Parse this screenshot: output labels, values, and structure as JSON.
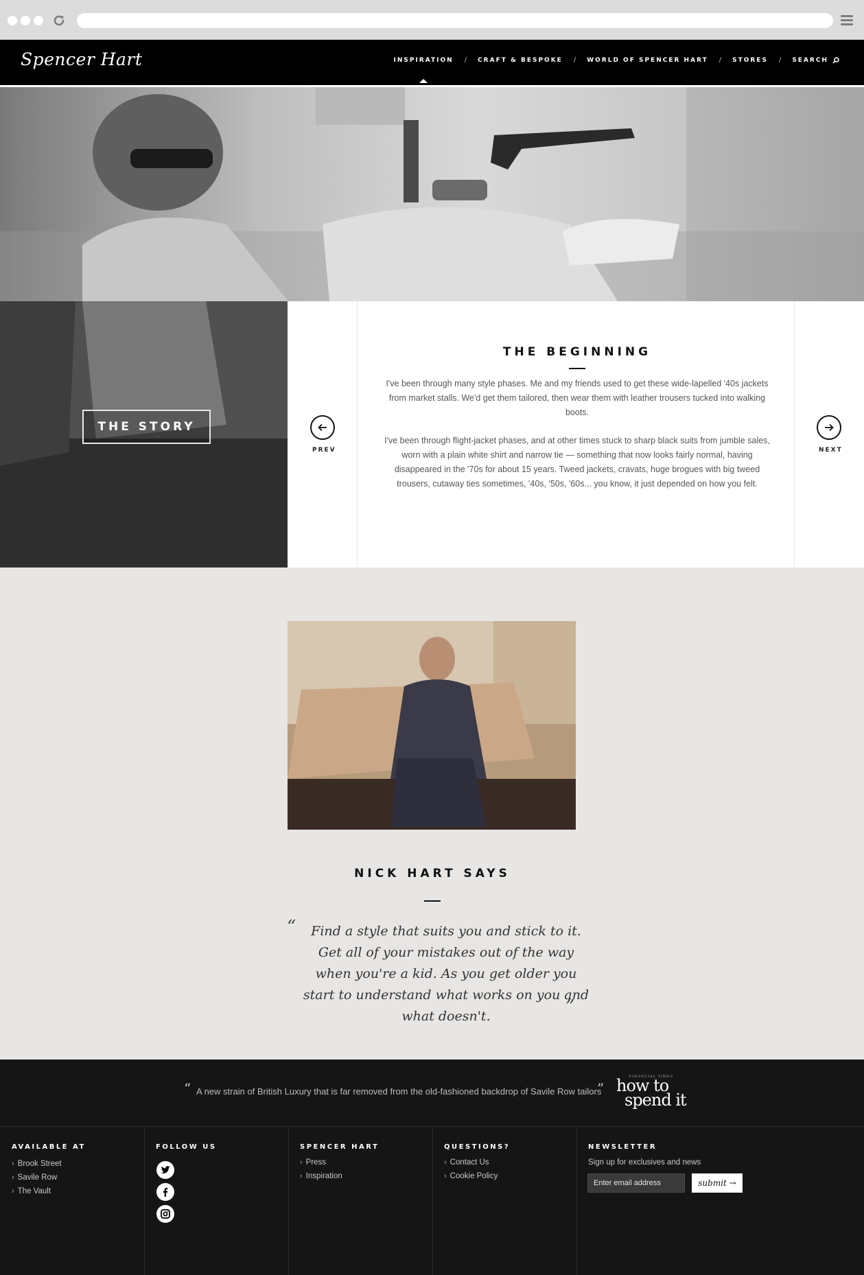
{
  "browser": {
    "url": ""
  },
  "header": {
    "logo": "Spencer Hart",
    "nav": [
      {
        "label": "INSPIRATION"
      },
      {
        "label": "CRAFT & BESPOKE"
      },
      {
        "label": "WORLD OF SPENCER HART"
      },
      {
        "label": "STORES"
      },
      {
        "label": "SEARCH"
      }
    ],
    "separator": "/",
    "active_index": 0
  },
  "story": {
    "button_label": "THE STORY",
    "title": "THE BEGINNING",
    "paragraphs": [
      "I've been through many style phases. Me and my friends used to get these wide-lapelled '40s jackets from market stalls. We'd get them tailored, then wear them with leather trousers tucked into walking boots.",
      "I've been through flight-jacket phases, and at other times stuck to sharp black suits from jumble sales, worn with a plain white shirt and narrow tie — something that now looks fairly normal, having disappeared in the '70s for about 15 years. Tweed jackets, cravats, huge brogues with big tweed trousers, cutaway ties sometimes, '40s, '50s, '60s... you know, it just depended on how you felt."
    ],
    "prev_label": "PREV",
    "next_label": "NEXT"
  },
  "quote": {
    "title": "NICK HART SAYS",
    "open_mark": "“",
    "close_mark": "”",
    "text": "Find a style that suits you and stick to it. Get all of your mistakes out of the way when you're a kid. As you get older you start to understand what works on you and what doesn't."
  },
  "footer": {
    "press_quote": "A new strain of British Luxury that is far removed from the old-fashioned backdrop of Savile Row tailors",
    "press_open": "“",
    "press_close": "”",
    "press_logo_line1": "how to",
    "press_logo_line2": "spend it",
    "press_logo_small": "FINANCIAL TIMES",
    "columns": {
      "available": {
        "title": "AVAILABLE AT",
        "links": [
          "Brook Street",
          "Savile Row",
          "The Vault"
        ]
      },
      "follow": {
        "title": "FOLLOW US",
        "icons": [
          "twitter-icon",
          "facebook-icon",
          "instagram-icon"
        ]
      },
      "brand": {
        "title": "SPENCER HART",
        "links": [
          "Press",
          "Inspiration"
        ]
      },
      "questions": {
        "title": "QUESTIONS?",
        "links": [
          "Contact Us",
          "Cookie Policy"
        ]
      },
      "newsletter": {
        "title": "NEWSLETTER",
        "subtitle": "Sign up for exclusives and news",
        "placeholder": "Enter email address",
        "submit_label": "submit →"
      }
    },
    "chevron": "›"
  }
}
